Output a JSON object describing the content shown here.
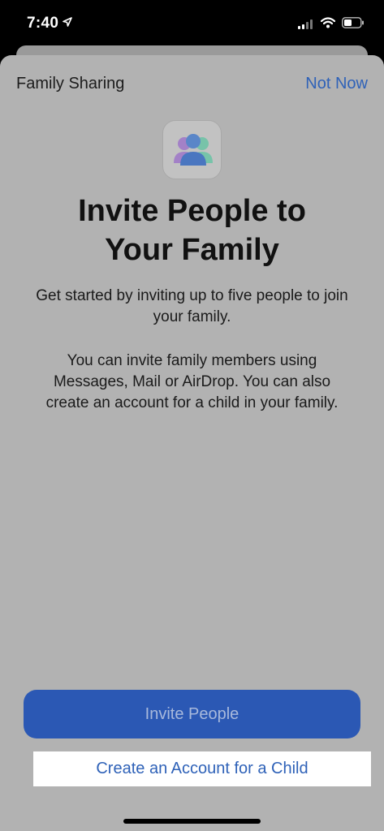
{
  "status_bar": {
    "time": "7:40",
    "icons": [
      "location-arrow-icon",
      "cellular-signal-icon",
      "wifi-icon",
      "battery-icon"
    ]
  },
  "nav": {
    "title": "Family Sharing",
    "action_label": "Not Now"
  },
  "hero": {
    "icon": "family-people-icon",
    "headline_line1": "Invite People to",
    "headline_line2": "Your Family"
  },
  "body": {
    "paragraph1_line1": "Get started by inviting up to five people to join",
    "paragraph1_line2": "your family.",
    "paragraph2_line1": "You can invite family members using",
    "paragraph2_line2": "Messages, Mail or AirDrop. You can also",
    "paragraph2_line3": "create an account for a child in your family."
  },
  "actions": {
    "primary_label": "Invite People",
    "secondary_label": "Create an Account for a Child"
  },
  "colors": {
    "accent": "#2f62b8",
    "primary_button": "#2b58b4",
    "sheet_background": "#b2b2b2"
  }
}
